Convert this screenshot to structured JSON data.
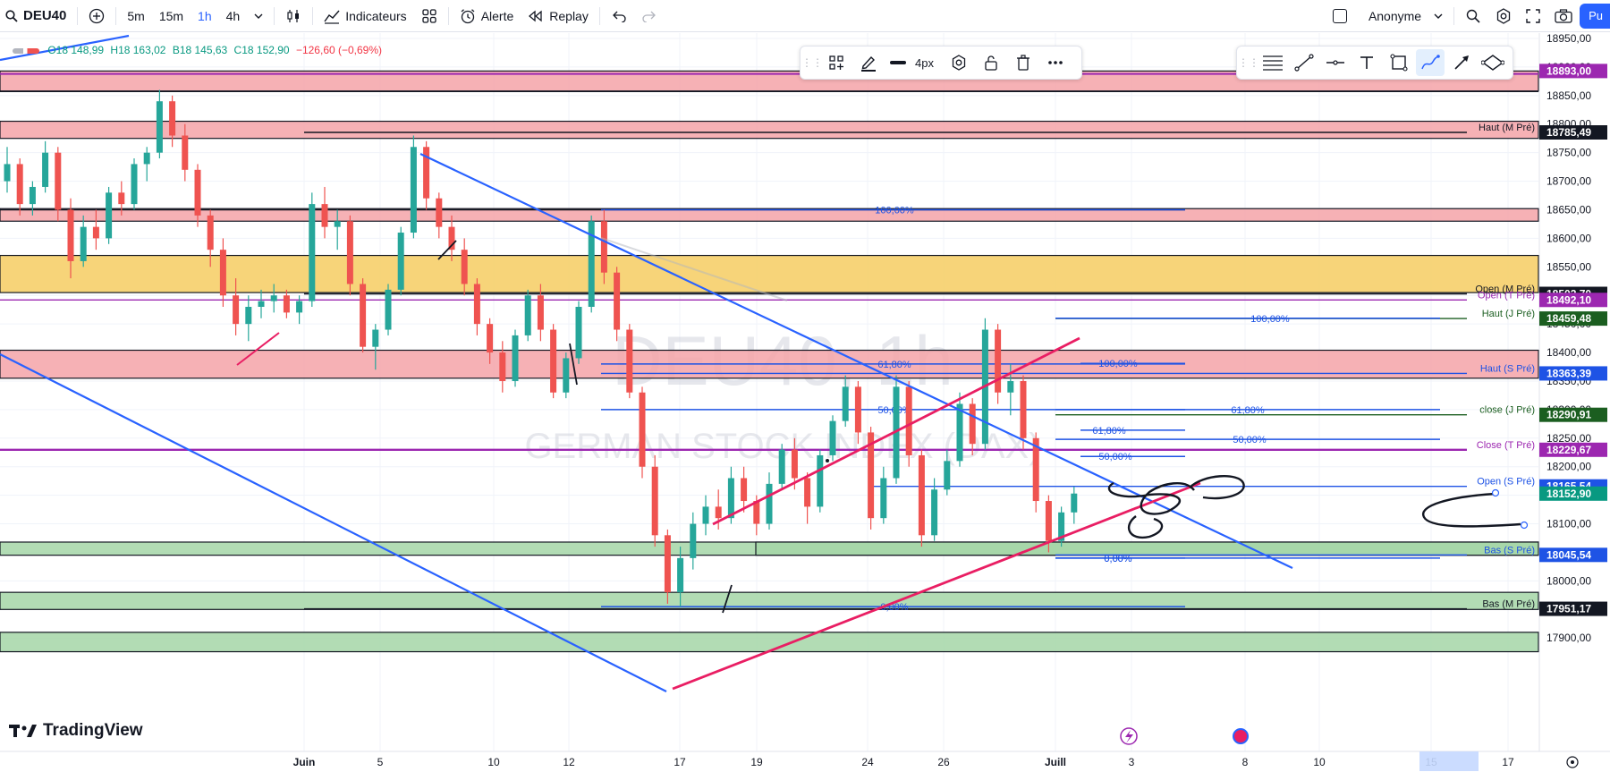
{
  "toolbar": {
    "symbol": "DEU40",
    "timeframes": [
      "5m",
      "15m",
      "1h",
      "4h"
    ],
    "active_timeframe": "1h",
    "indicators_label": "Indicateurs",
    "alert_label": "Alerte",
    "replay_label": "Replay",
    "account_label": "Anonyme",
    "publish_label": "Pu"
  },
  "drawing_toolbar": {
    "width_label": "4px"
  },
  "ohlc": {
    "open": "O18 148,99",
    "high": "H18 163,02",
    "low": "B18 145,63",
    "close": "C18 152,90",
    "change": "−126,60 (−0,69%)"
  },
  "watermark": {
    "symbol": "DEU40, 1h",
    "name": "GERMAN STOCK INDEX (DAX)"
  },
  "logo_text": "TradingView",
  "colors": {
    "up": "#26a69a",
    "down": "#ef5350",
    "trend": "#2962ff",
    "channel": "#e91e63",
    "zone_red": "#f5a3a8",
    "zone_yellow": "#f6cd62",
    "zone_green": "#a5d6a7"
  },
  "chart_data": {
    "type": "candlestick",
    "symbol": "DEU40",
    "interval": "1h",
    "ylim": [
      17860,
      18980
    ],
    "y_ticks": [
      "18950,00",
      "18900,00",
      "18850,00",
      "18800,00",
      "18750,00",
      "18700,00",
      "18650,00",
      "18600,00",
      "18550,00",
      "18500,00",
      "18450,00",
      "18400,00",
      "18350,00",
      "18300,00",
      "18250,00",
      "18200,00",
      "18150,00",
      "18100,00",
      "18050,00",
      "18000,00",
      "17950,00",
      "17900,00"
    ],
    "x_ticks": [
      "Juin",
      "5",
      "10",
      "12",
      "17",
      "19",
      "24",
      "26",
      "Juill",
      "3",
      "8",
      "10",
      "15",
      "17"
    ],
    "price_levels": [
      {
        "label": "Haut (M Pré)",
        "price": "18785,49",
        "value": 18785.49,
        "color": "#131722"
      },
      {
        "label": "Open (M Pré)",
        "price": "18502,70",
        "value": 18502.7,
        "color": "#131722"
      },
      {
        "label": "Open (T Pré)",
        "price": "18492,10",
        "value": 18492.1,
        "color": "#9c27b0"
      },
      {
        "label": "Haut (J Pré)",
        "price": "18459,48",
        "value": 18459.48,
        "color": "#1b5e20"
      },
      {
        "label": "Haut (S Pré)",
        "price": "18363,39",
        "value": 18363.39,
        "color": "#1e53e5"
      },
      {
        "label": "close (J Pré)",
        "price": "18290,91",
        "value": 18290.91,
        "color": "#1b5e20"
      },
      {
        "label": "Close (T Pré)",
        "price": "18229,67",
        "value": 18229.67,
        "color": "#9c27b0"
      },
      {
        "label": "Open (S Pré)",
        "price": "18165,54",
        "value": 18165.54,
        "color": "#1e53e5"
      },
      {
        "label": "Bas (S Pré)",
        "price": "18045,54",
        "value": 18045.54,
        "color": "#1e53e5"
      },
      {
        "label": "Bas (M Pré)",
        "price": "17951,17",
        "value": 17951.17,
        "color": "#131722"
      }
    ],
    "top_price_tag": {
      "price": "18893,00",
      "value": 18893,
      "color": "#9c27b0"
    },
    "last_price": {
      "price": "18152,90",
      "value": 18152.9,
      "color": "#089981"
    },
    "fib_labels": [
      "100,00%",
      "61,80%",
      "50,00%",
      "0,00%"
    ],
    "zones": [
      {
        "from": 18858,
        "to": 18893,
        "color": "red"
      },
      {
        "from": 18775,
        "to": 18805,
        "color": "red"
      },
      {
        "from": 18630,
        "to": 18652,
        "color": "red"
      },
      {
        "from": 18505,
        "to": 18570,
        "color": "yellow"
      },
      {
        "from": 18355,
        "to": 18404,
        "color": "red"
      },
      {
        "from": 18045,
        "to": 18068,
        "color": "green"
      },
      {
        "from": 17950,
        "to": 17980,
        "color": "green"
      },
      {
        "from": 17876,
        "to": 17910,
        "color": "green"
      }
    ],
    "candles": [
      [
        18700,
        18760,
        18680,
        18730
      ],
      [
        18730,
        18740,
        18640,
        18660
      ],
      [
        18660,
        18700,
        18640,
        18690
      ],
      [
        18690,
        18770,
        18680,
        18750
      ],
      [
        18750,
        18760,
        18630,
        18650
      ],
      [
        18650,
        18670,
        18530,
        18560
      ],
      [
        18560,
        18640,
        18550,
        18620
      ],
      [
        18620,
        18650,
        18580,
        18600
      ],
      [
        18600,
        18690,
        18590,
        18680
      ],
      [
        18680,
        18700,
        18640,
        18660
      ],
      [
        18660,
        18740,
        18650,
        18730
      ],
      [
        18730,
        18760,
        18700,
        18750
      ],
      [
        18750,
        18860,
        18740,
        18840
      ],
      [
        18840,
        18850,
        18760,
        18780
      ],
      [
        18780,
        18800,
        18700,
        18720
      ],
      [
        18720,
        18730,
        18620,
        18640
      ],
      [
        18640,
        18650,
        18550,
        18580
      ],
      [
        18580,
        18600,
        18480,
        18500
      ],
      [
        18500,
        18530,
        18430,
        18450
      ],
      [
        18450,
        18500,
        18420,
        18480
      ],
      [
        18480,
        18510,
        18460,
        18490
      ],
      [
        18490,
        18520,
        18470,
        18500
      ],
      [
        18500,
        18510,
        18460,
        18470
      ],
      [
        18470,
        18500,
        18450,
        18490
      ],
      [
        18490,
        18680,
        18480,
        18660
      ],
      [
        18660,
        18690,
        18600,
        18620
      ],
      [
        18620,
        18650,
        18580,
        18630
      ],
      [
        18630,
        18640,
        18500,
        18520
      ],
      [
        18520,
        18530,
        18400,
        18410
      ],
      [
        18410,
        18450,
        18370,
        18440
      ],
      [
        18440,
        18520,
        18430,
        18510
      ],
      [
        18510,
        18620,
        18500,
        18610
      ],
      [
        18610,
        18780,
        18600,
        18760
      ],
      [
        18760,
        18770,
        18650,
        18670
      ],
      [
        18670,
        18680,
        18600,
        18620
      ],
      [
        18620,
        18640,
        18560,
        18580
      ],
      [
        18580,
        18600,
        18500,
        18520
      ],
      [
        18520,
        18530,
        18430,
        18450
      ],
      [
        18450,
        18460,
        18380,
        18400
      ],
      [
        18400,
        18420,
        18330,
        18350
      ],
      [
        18350,
        18440,
        18340,
        18430
      ],
      [
        18430,
        18510,
        18420,
        18500
      ],
      [
        18500,
        18520,
        18420,
        18440
      ],
      [
        18440,
        18450,
        18320,
        18330
      ],
      [
        18330,
        18400,
        18320,
        18390
      ],
      [
        18390,
        18490,
        18380,
        18480
      ],
      [
        18480,
        18640,
        18470,
        18630
      ],
      [
        18630,
        18650,
        18520,
        18540
      ],
      [
        18540,
        18550,
        18420,
        18440
      ],
      [
        18440,
        18450,
        18320,
        18330
      ],
      [
        18330,
        18340,
        18180,
        18200
      ],
      [
        18200,
        18220,
        18060,
        18080
      ],
      [
        18080,
        18090,
        17960,
        17980
      ],
      [
        17980,
        18060,
        17955,
        18040
      ],
      [
        18040,
        18120,
        18020,
        18100
      ],
      [
        18100,
        18150,
        18080,
        18130
      ],
      [
        18130,
        18160,
        18090,
        18110
      ],
      [
        18110,
        18200,
        18100,
        18180
      ],
      [
        18180,
        18200,
        18120,
        18140
      ],
      [
        18140,
        18150,
        18080,
        18100
      ],
      [
        18100,
        18190,
        18090,
        18170
      ],
      [
        18170,
        18240,
        18160,
        18230
      ],
      [
        18230,
        18250,
        18160,
        18180
      ],
      [
        18180,
        18190,
        18100,
        18130
      ],
      [
        18130,
        18230,
        18120,
        18220
      ],
      [
        18220,
        18290,
        18210,
        18280
      ],
      [
        18280,
        18360,
        18270,
        18340
      ],
      [
        18340,
        18350,
        18240,
        18260
      ],
      [
        18260,
        18270,
        18090,
        18110
      ],
      [
        18110,
        18200,
        18100,
        18180
      ],
      [
        18180,
        18360,
        18170,
        18340
      ],
      [
        18340,
        18350,
        18200,
        18220
      ],
      [
        18220,
        18230,
        18060,
        18080
      ],
      [
        18080,
        18180,
        18070,
        18160
      ],
      [
        18160,
        18230,
        18150,
        18210
      ],
      [
        18210,
        18330,
        18200,
        18310
      ],
      [
        18310,
        18320,
        18220,
        18240
      ],
      [
        18240,
        18460,
        18230,
        18440
      ],
      [
        18440,
        18450,
        18310,
        18330
      ],
      [
        18330,
        18380,
        18290,
        18350
      ],
      [
        18350,
        18360,
        18230,
        18250
      ],
      [
        18250,
        18260,
        18120,
        18140
      ],
      [
        18140,
        18150,
        18050,
        18070
      ],
      [
        18070,
        18130,
        18060,
        18120
      ],
      [
        18120,
        18165,
        18100,
        18153
      ]
    ]
  }
}
